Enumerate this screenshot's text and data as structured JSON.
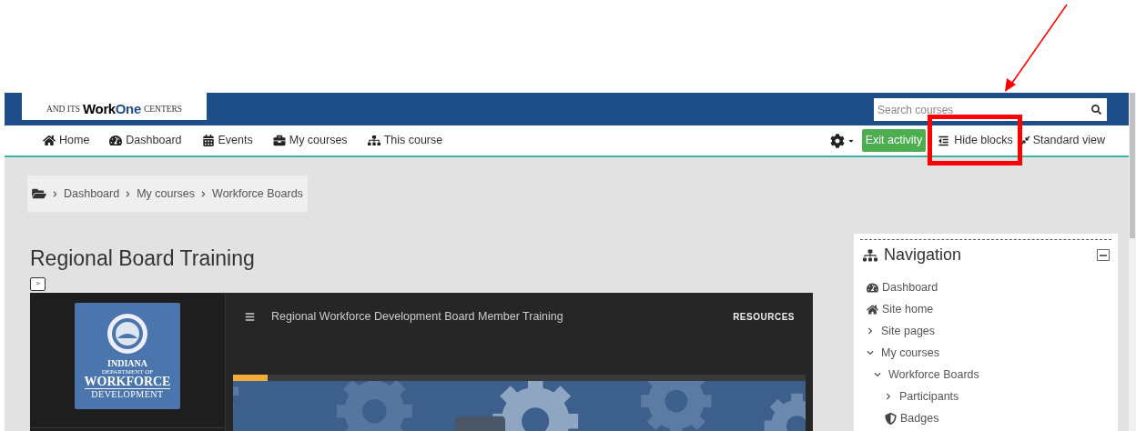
{
  "logo": {
    "prefix": "AND ITS",
    "brand_a": "Work",
    "brand_b": "One",
    "suffix": "CENTERS"
  },
  "search": {
    "placeholder": "Search courses"
  },
  "menu": [
    {
      "label": "Home"
    },
    {
      "label": "Dashboard"
    },
    {
      "label": "Events"
    },
    {
      "label": "My courses"
    },
    {
      "label": "This course"
    }
  ],
  "actions": {
    "exit": "Exit activity",
    "hide": "Hide blocks",
    "standard": "Standard view"
  },
  "breadcrumb": [
    "Dashboard",
    "My courses",
    "Workforce Boards"
  ],
  "title": "Regional Board Training",
  "toggle": ">",
  "player": {
    "logo_lines": [
      "INDIANA",
      "DEPARTMENT OF",
      "WORKFORCE",
      "DEVELOPMENT"
    ],
    "title": "Regional Workforce Development Board Member Training",
    "resources": "RESOURCES",
    "level": 0.06
  },
  "navigation": {
    "title": "Navigation",
    "items": [
      {
        "label": "Dashboard",
        "kind": "leaf"
      },
      {
        "label": "Site home",
        "kind": "leaf"
      },
      {
        "label": "Site pages",
        "kind": "branch",
        "expanded": false
      },
      {
        "label": "My courses",
        "kind": "branch",
        "expanded": true,
        "children": [
          {
            "label": "Workforce Boards",
            "kind": "branch",
            "expanded": true,
            "children": [
              {
                "label": "Participants",
                "kind": "branch",
                "expanded": false
              },
              {
                "label": "Badges",
                "kind": "leaf"
              }
            ]
          }
        ]
      }
    ]
  }
}
